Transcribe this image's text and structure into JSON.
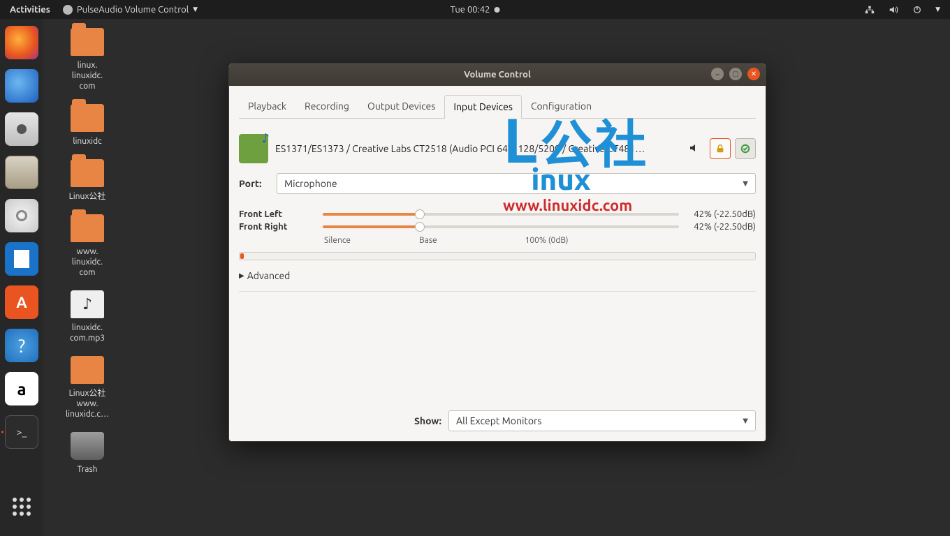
{
  "panel": {
    "activities": "Activities",
    "app_name": "PulseAudio Volume Control",
    "clock": "Tue 00:42"
  },
  "desktop_icons": [
    {
      "label": "linux.\nlinuxidc.\ncom",
      "type": "folder"
    },
    {
      "label": "linuxidc",
      "type": "folder"
    },
    {
      "label": "Linux公社",
      "type": "folder"
    },
    {
      "label": "www.\nlinuxidc.\ncom",
      "type": "folder"
    },
    {
      "label": "linuxidc.\ncom.mp3",
      "type": "file"
    },
    {
      "label": "Linux公社\nwww.\nlinuxidc.c…",
      "type": "file"
    },
    {
      "label": "Trash",
      "type": "trash"
    }
  ],
  "window": {
    "title": "Volume Control",
    "tabs": [
      "Playback",
      "Recording",
      "Output Devices",
      "Input Devices",
      "Configuration"
    ],
    "active_tab_index": 3,
    "device_name": "ES1371/ES1373 / Creative Labs CT2518 (Audio PCI 64V, 128/5200 / Creative CT481…",
    "port_label": "Port:",
    "port_value": "Microphone",
    "channels": [
      {
        "label": "Front Left",
        "percent": 42,
        "value_text": "42% (-22.50dB)"
      },
      {
        "label": "Front Right",
        "percent": 42,
        "value_text": "42% (-22.50dB)"
      }
    ],
    "scale": {
      "silence": "Silence",
      "base": "Base",
      "hundred": "100% (0dB)"
    },
    "advanced": "Advanced",
    "show_label": "Show:",
    "show_value": "All Except Monitors"
  },
  "watermark": {
    "line1": "公社",
    "line2": "inux",
    "url": "www.linuxidc.com"
  }
}
